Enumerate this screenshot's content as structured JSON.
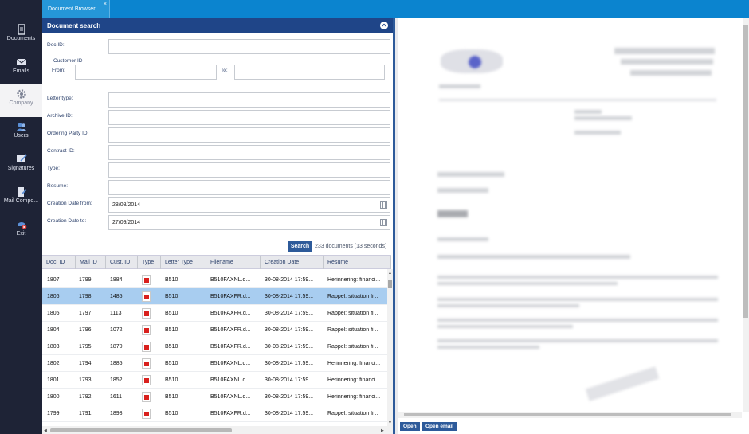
{
  "sidebar": {
    "items": [
      {
        "label": "Documents",
        "icon": "document-icon"
      },
      {
        "label": "Emails",
        "icon": "envelope-icon"
      },
      {
        "label": "Company",
        "icon": "gear-icon",
        "active": true
      },
      {
        "label": "Users",
        "icon": "users-icon"
      },
      {
        "label": "Signatures",
        "icon": "signature-pen-icon"
      },
      {
        "label": "Mail Compo...",
        "icon": "compose-icon"
      },
      {
        "label": "Exit",
        "icon": "exit-icon"
      }
    ]
  },
  "tab": {
    "label": "Document Browser",
    "close": "×"
  },
  "search": {
    "title": "Document search",
    "doc_id_label": "Doc ID:",
    "customer_id_label": "Customer ID",
    "from_label": "From:",
    "to_label": "To:",
    "letter_type_label": "Letter type:",
    "archive_id_label": "Archive ID:",
    "ordering_party_label": "Ordering Party ID:",
    "contract_id_label": "Contract ID:",
    "type_label": "Type:",
    "resume_label": "Resume:",
    "date_from_label": "Creation Date from:",
    "date_from_value": "28/08/2014",
    "date_to_label": "Creation Date to:",
    "date_to_value": "27/09/2014",
    "button_label": "Search",
    "result_count": "233 documents (13 seconds)"
  },
  "table": {
    "columns": [
      "Doc. ID",
      "Mail ID",
      "Cust. ID",
      "Type",
      "Letter Type",
      "Filename",
      "Creation Date",
      "Resume"
    ],
    "rows": [
      {
        "doc_id": "1807",
        "mail_id": "1799",
        "cust_id": "1884",
        "letter_type": "B510",
        "filename": "B510FAXNL.d...",
        "date": "30-08-2014 17:59...",
        "resume": "Herinnering: financi..."
      },
      {
        "doc_id": "1806",
        "mail_id": "1798",
        "cust_id": "1485",
        "letter_type": "B510",
        "filename": "B510FAXFR.d...",
        "date": "30-08-2014 17:59...",
        "resume": "Rappel: situation fi...",
        "selected": true
      },
      {
        "doc_id": "1805",
        "mail_id": "1797",
        "cust_id": "1113",
        "letter_type": "B510",
        "filename": "B510FAXFR.d...",
        "date": "30-08-2014 17:59...",
        "resume": "Rappel: situation fi..."
      },
      {
        "doc_id": "1804",
        "mail_id": "1796",
        "cust_id": "1072",
        "letter_type": "B510",
        "filename": "B510FAXFR.d...",
        "date": "30-08-2014 17:59...",
        "resume": "Rappel: situation fi..."
      },
      {
        "doc_id": "1803",
        "mail_id": "1795",
        "cust_id": "1870",
        "letter_type": "B510",
        "filename": "B510FAXFR.d...",
        "date": "30-08-2014 17:59...",
        "resume": "Rappel: situation fi..."
      },
      {
        "doc_id": "1802",
        "mail_id": "1794",
        "cust_id": "1885",
        "letter_type": "B510",
        "filename": "B510FAXNL.d...",
        "date": "30-08-2014 17:59...",
        "resume": "Herinnering: financi..."
      },
      {
        "doc_id": "1801",
        "mail_id": "1793",
        "cust_id": "1852",
        "letter_type": "B510",
        "filename": "B510FAXNL.d...",
        "date": "30-08-2014 17:59...",
        "resume": "Herinnering: financi..."
      },
      {
        "doc_id": "1800",
        "mail_id": "1792",
        "cust_id": "1611",
        "letter_type": "B510",
        "filename": "B510FAXNL.d...",
        "date": "30-08-2014 17:59...",
        "resume": "Herinnering: financi..."
      },
      {
        "doc_id": "1799",
        "mail_id": "1791",
        "cust_id": "1898",
        "letter_type": "B510",
        "filename": "B510FAXFR.d...",
        "date": "30-08-2014 17:59...",
        "resume": "Rappel: situation fi..."
      }
    ]
  },
  "preview": {
    "open_label": "Open",
    "open_email_label": "Open email"
  }
}
